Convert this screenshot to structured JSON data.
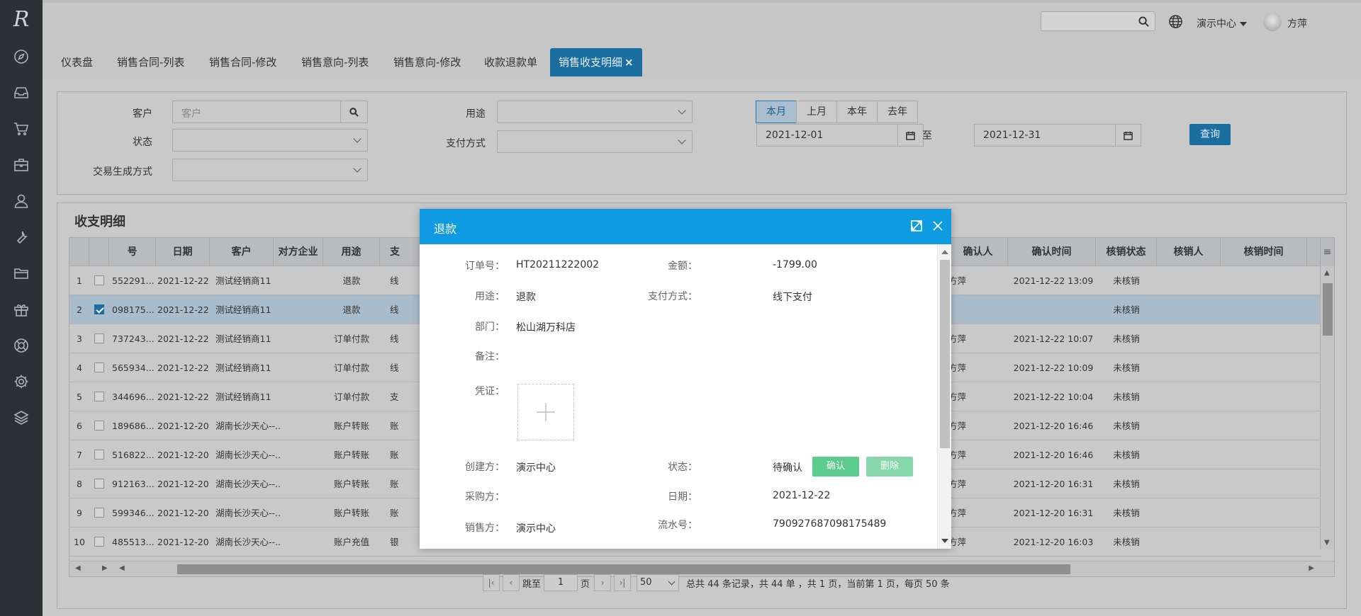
{
  "app": {
    "logo": "R"
  },
  "sidebar": {
    "icons": [
      "compass-icon",
      "inbox-icon",
      "cart-icon",
      "briefcase-icon",
      "user-icon",
      "wrench-icon",
      "folder-icon",
      "gift-icon",
      "lifebuoy-icon",
      "settings-icon",
      "layers-icon"
    ]
  },
  "header": {
    "search_placeholder": "",
    "org_name": "演示中心",
    "username": "方萍",
    "help": "?"
  },
  "tabs": [
    {
      "label": "仪表盘"
    },
    {
      "label": "销售合同-列表"
    },
    {
      "label": "销售合同-修改"
    },
    {
      "label": "销售意向-列表"
    },
    {
      "label": "销售意向-修改"
    },
    {
      "label": "收款退款单"
    },
    {
      "label": "销售收支明细",
      "active": true,
      "close": "×"
    }
  ],
  "filters": {
    "customer_label": "客户",
    "customer_placeholder": "客户",
    "status_label": "状态",
    "trade_label": "交易生成方式",
    "purpose_label": "用途",
    "pay_label": "支付方式",
    "periods": [
      "本月",
      "上月",
      "本年",
      "去年"
    ],
    "active_period": "本月",
    "date_from": "2021-12-01",
    "date_sep": "至",
    "date_to": "2021-12-31",
    "query_label": "查询"
  },
  "list": {
    "title": "收支明细",
    "columns": [
      "号",
      "日期",
      "客户",
      "对方企业",
      "用途",
      "支",
      "确认人",
      "确认时间",
      "核销状态",
      "核销人",
      "核销时间"
    ],
    "rows": [
      {
        "n": "1",
        "checked": false,
        "no": "552291...",
        "date": "2021-12-22",
        "cust": "测试经销商11",
        "use": "退款",
        "pay": "线",
        "confirmer": "方萍",
        "ctime": "2021-12-22 13:09",
        "status": "未核销"
      },
      {
        "n": "2",
        "checked": true,
        "no": "098175...",
        "date": "2021-12-22",
        "cust": "测试经销商11",
        "use": "退款",
        "pay": "线",
        "confirmer": "",
        "ctime": "",
        "status": "未核销"
      },
      {
        "n": "3",
        "checked": false,
        "no": "737243...",
        "date": "2021-12-22",
        "cust": "测试经销商11",
        "use": "订单付款",
        "pay": "线",
        "confirmer": "方萍",
        "ctime": "2021-12-22 10:07",
        "status": "未核销"
      },
      {
        "n": "4",
        "checked": false,
        "no": "565934...",
        "date": "2021-12-22",
        "cust": "测试经销商11",
        "use": "订单付款",
        "pay": "线",
        "confirmer": "方萍",
        "ctime": "2021-12-22 10:09",
        "status": "未核销"
      },
      {
        "n": "5",
        "checked": false,
        "no": "344696...",
        "date": "2021-12-22",
        "cust": "测试经销商11",
        "use": "订单付款",
        "pay": "支",
        "confirmer": "方萍",
        "ctime": "2021-12-22 10:04",
        "status": "未核销"
      },
      {
        "n": "6",
        "checked": false,
        "no": "189686...",
        "date": "2021-12-20",
        "cust": "湖南长沙天心--...",
        "use": "账户转账",
        "pay": "账",
        "confirmer": "方萍",
        "ctime": "2021-12-20 16:46",
        "status": "未核销"
      },
      {
        "n": "7",
        "checked": false,
        "no": "516822...",
        "date": "2021-12-20",
        "cust": "湖南长沙天心--...",
        "use": "账户转账",
        "pay": "账",
        "confirmer": "方萍",
        "ctime": "2021-12-20 16:46",
        "status": "未核销"
      },
      {
        "n": "8",
        "checked": false,
        "no": "912163...",
        "date": "2021-12-20",
        "cust": "湖南长沙天心--...",
        "use": "账户转账",
        "pay": "账",
        "confirmer": "方萍",
        "ctime": "2021-12-20 16:31",
        "status": "未核销"
      },
      {
        "n": "9",
        "checked": false,
        "no": "599346...",
        "date": "2021-12-20",
        "cust": "湖南长沙天心--...",
        "use": "账户转账",
        "pay": "账",
        "confirmer": "方萍",
        "ctime": "2021-12-20 16:31",
        "status": "未核销"
      },
      {
        "n": "10",
        "checked": false,
        "no": "485513...",
        "date": "2021-12-20",
        "cust": "湖南长沙天心--...",
        "use": "账户充值",
        "pay": "银",
        "confirmer": "方萍",
        "ctime": "2021-12-20 16:03",
        "status": "未核销"
      }
    ]
  },
  "pager": {
    "goto_label": "跳至",
    "page": "1",
    "page_unit": "页",
    "page_size": "50",
    "summary": "总共 44 条记录，共 44 单 ，共 1 页，当前第 1 页，每页 50 条"
  },
  "modal": {
    "title": "退款",
    "order_no_label": "订单号：",
    "order_no": "HT20211222002",
    "amount_label": "金额：",
    "amount": "-1799.00",
    "purpose_label": "用途：",
    "purpose": "退款",
    "pay_label": "支付方式：",
    "pay": "线下支付",
    "dept_label": "部门：",
    "dept": "松山湖万科店",
    "remark_label": "备注：",
    "voucher_label": "凭证：",
    "creator_label": "创建方：",
    "creator": "演示中心",
    "status_label": "状态：",
    "status": "待确认",
    "confirm_label": "确认",
    "delete_label": "删除",
    "buyer_label": "采购方：",
    "date_label": "日期：",
    "date": "2021-12-22",
    "seller_label": "销售方：",
    "seller": "演示中心",
    "serial_label": "流水号：",
    "serial": "790927687098175489"
  }
}
